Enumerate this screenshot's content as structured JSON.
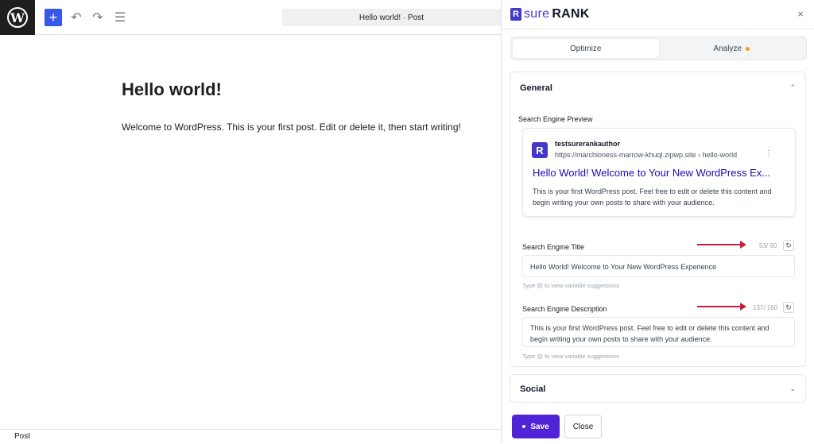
{
  "editor": {
    "document_title": "Hello world! · Post",
    "post_title": "Hello world!",
    "post_body": "Welcome to WordPress. This is your first post. Edit or delete it, then start writing!",
    "footer_breadcrumb": "Post",
    "icons": {
      "logo": "wordpress-logo-icon",
      "add": "plus-icon",
      "undo": "undo-icon",
      "redo": "redo-icon",
      "list_view": "list-view-icon"
    },
    "glyphs": {
      "logo": "W",
      "add": "+",
      "undo": "↶",
      "redo": "↷",
      "list_view": "☰"
    },
    "accent": "#3858e9"
  },
  "panel": {
    "brand_prefix": "sure",
    "brand_suffix": "RANK",
    "brand_mark": "R",
    "close_glyph": "×",
    "brand_color": "#4338ca",
    "tabs": [
      {
        "label": "Optimize",
        "active": true
      },
      {
        "label": "Analyze",
        "active": false,
        "indicator": "amber-dot",
        "indicator_color": "#f59e0b"
      }
    ],
    "general": {
      "title": "General",
      "expanded": true,
      "chevron_glyph": "⌃",
      "preview_label": "Search Engine Preview",
      "preview": {
        "favicon_glyph": "R",
        "site_name": "testsurerankauthor",
        "url": "https://marchioness-marrow-khuql.zipwp.site › hello-world",
        "kebab_glyph": "⋮",
        "title": "Hello World! Welcome to Your New WordPress Ex...",
        "description": "This is your first WordPress post. Feel free to edit or delete this content and begin writing your own posts to share with your audience."
      },
      "title_field": {
        "label": "Search Engine Title",
        "counter": "53/ 60",
        "value": "Hello World! Welcome to Your New WordPress Experience",
        "hint": "Type @ to view variable suggestions"
      },
      "description_field": {
        "label": "Search Engine Description",
        "counter": "137/ 160",
        "value": "This is your first WordPress post. Feel free to edit or delete this content and begin writing your own posts to share with your audience.",
        "hint": "Type @ to view variable suggestions"
      },
      "refresh_glyph": "↻"
    },
    "social": {
      "title": "Social",
      "expanded": false,
      "chevron_glyph": "⌄"
    },
    "buttons": {
      "save": "Save",
      "close": "Close"
    },
    "save_color": "#4f24d6"
  }
}
